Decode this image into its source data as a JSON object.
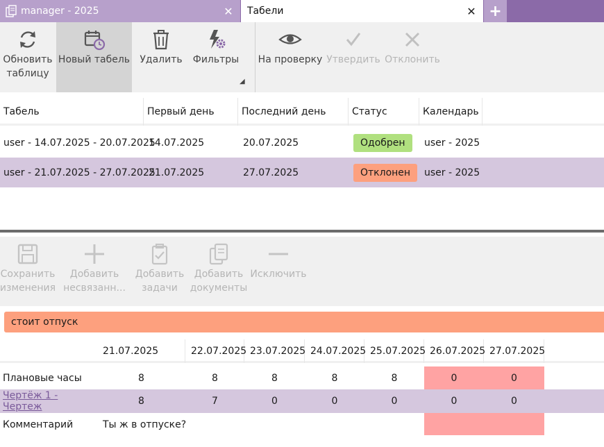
{
  "tabs": {
    "inactive_title": "manager - 2025",
    "active_title": "Табели",
    "close_glyph": "✕",
    "add_glyph": "+"
  },
  "toolbar1": {
    "refresh": {
      "line1": "Обновить",
      "line2": "таблицу",
      "icon": "refresh-icon"
    },
    "new": {
      "label": "Новый табель",
      "icon": "calendar-clock-icon"
    },
    "delete": {
      "label": "Удалить",
      "icon": "trash-icon"
    },
    "filters": {
      "label": "Фильтры",
      "icon": "filter-gear-icon"
    },
    "review": {
      "label": "На проверку",
      "icon": "eye-icon"
    },
    "approve": {
      "label": "Утвердить",
      "icon": "check-icon"
    },
    "reject": {
      "label": "Отклонить",
      "icon": "x-icon"
    }
  },
  "timesheets": {
    "columns": [
      "Табель",
      "Первый день",
      "Последний день",
      "Статус",
      "Календарь"
    ],
    "rows": [
      {
        "name": "user - 14.07.2025 - 20.07.2025",
        "first": "14.07.2025",
        "last": "20.07.2025",
        "status": "Одобрен",
        "status_color": "#b0e07f",
        "calendar": "user - 2025"
      },
      {
        "name": "user - 21.07.2025 - 27.07.2025",
        "first": "21.07.2025",
        "last": "27.07.2025",
        "status": "Отклонен",
        "status_color": "#fda07e",
        "calendar": "user - 2025"
      }
    ]
  },
  "toolbar2": {
    "save": {
      "line1": "Сохранить",
      "line2": "изменения"
    },
    "add_unlinked": {
      "line1": "Добавить",
      "line2": "несвязанн..."
    },
    "add_tasks": {
      "line1": "Добавить",
      "line2": "задачи"
    },
    "add_docs": {
      "line1": "Добавить",
      "line2": "документы"
    },
    "exclude": {
      "label": "Исключить"
    }
  },
  "alert": {
    "text": "стоит отпуск",
    "color": "#fda07e"
  },
  "detail": {
    "dates": [
      "21.07.2025",
      "22.07.2025",
      "23.07.2025",
      "24.07.2025",
      "25.07.2025",
      "26.07.2025",
      "27.07.2025"
    ],
    "rows": [
      {
        "label": "Плановые часы",
        "values": [
          "8",
          "8",
          "8",
          "8",
          "8",
          "0",
          "0"
        ]
      },
      {
        "label": "Чертёж 1 - Чертеж",
        "values": [
          "8",
          "7",
          "0",
          "0",
          "0",
          "0",
          "0"
        ]
      }
    ],
    "comment": {
      "label": "Комментарий",
      "text": "Ты ж в отпуске?"
    }
  },
  "colors": {
    "accent": "#8b6aa8",
    "selected_row": "#d5c7de",
    "weekend": "#ffa3a3",
    "link": "#7a5a9a"
  }
}
